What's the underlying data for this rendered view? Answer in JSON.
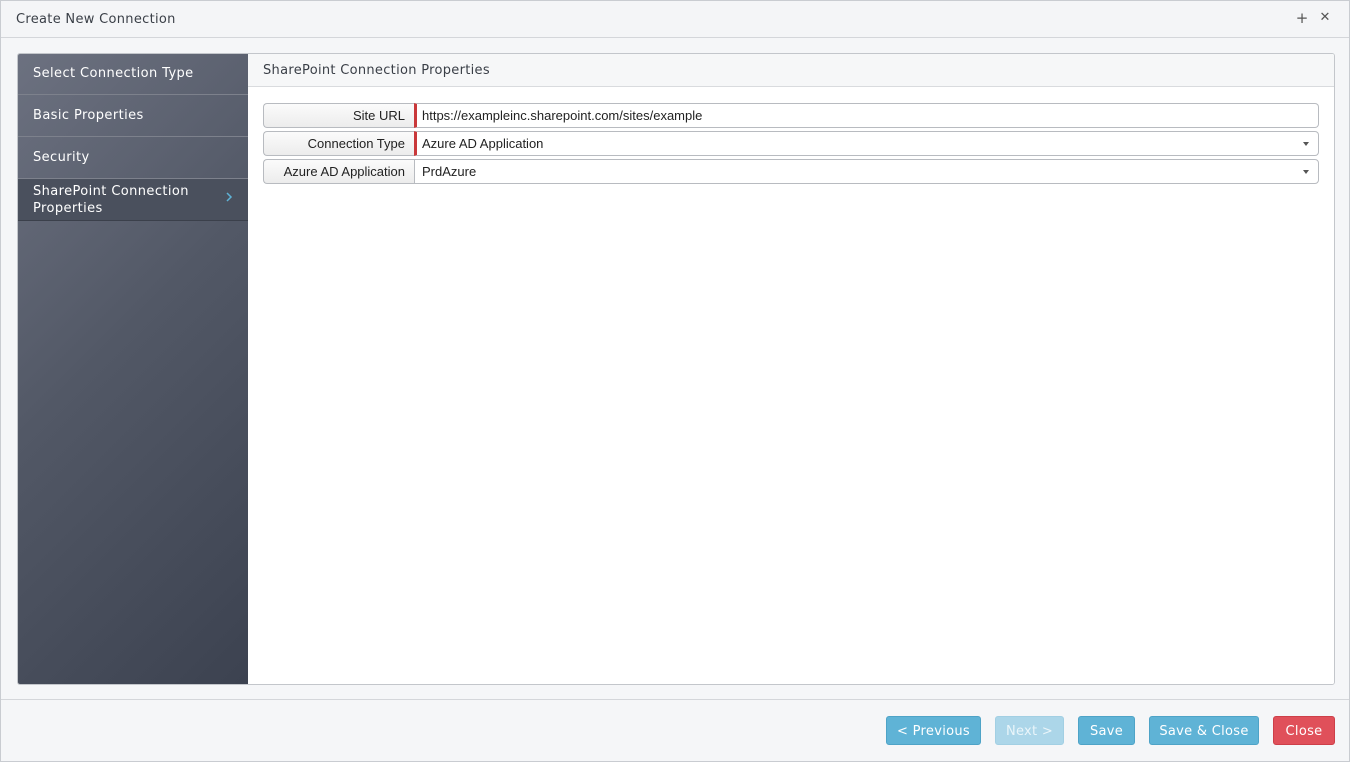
{
  "window": {
    "title": "Create New Connection",
    "maximize_glyph": "+",
    "close_glyph": "✕"
  },
  "sidebar": {
    "items": [
      {
        "label": "Select Connection Type"
      },
      {
        "label": "Basic Properties"
      },
      {
        "label": "Security"
      },
      {
        "label_line1": "SharePoint Connection",
        "label_line2": "Properties",
        "active": true,
        "icon": "chevron-right-icon"
      }
    ]
  },
  "content": {
    "header": "SharePoint Connection Properties",
    "fields": [
      {
        "label": "Site URL",
        "value": "https://exampleinc.sharepoint.com/sites/example",
        "required": true,
        "type": "text"
      },
      {
        "label": "Connection Type",
        "value": "Azure AD Application",
        "required": true,
        "type": "select"
      },
      {
        "label": "Azure AD Application",
        "value": "PrdAzure",
        "required": false,
        "type": "select"
      }
    ]
  },
  "footer": {
    "previous": "< Previous",
    "next": "Next >",
    "save": "Save",
    "save_close": "Save & Close",
    "close": "Close"
  },
  "colors": {
    "accent": "#5fb3d6",
    "danger": "#e0505a",
    "required_marker": "#c9383a",
    "sidebar_dark": "#3c4250"
  }
}
